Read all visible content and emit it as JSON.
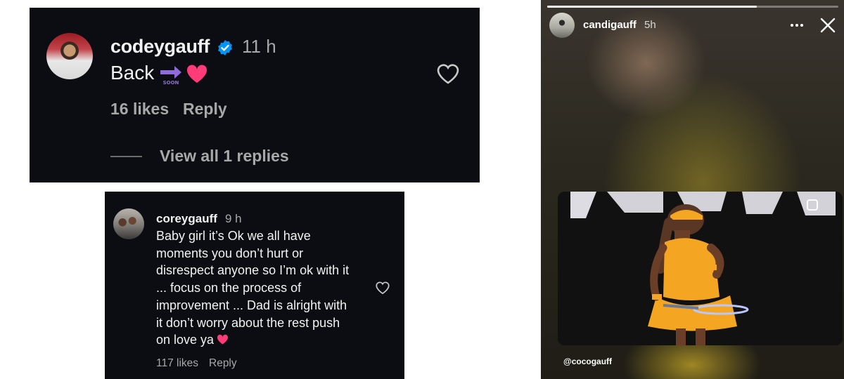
{
  "comment1": {
    "username": "codeygauff",
    "time": "11 h",
    "text": "Back",
    "likes": "16 likes",
    "reply": "Reply",
    "view_replies": "View all 1 replies",
    "emoji_icons": [
      "soon-arrow-icon",
      "heart-icon"
    ],
    "verified": true
  },
  "comment2": {
    "username": "coreygauff",
    "time": "9 h",
    "lines": [
      "Baby girl it’s Ok we all have",
      "moments you don’t hurt or",
      "disrespect anyone so I’m ok with it",
      "... focus on the process of",
      "improvement ... Dad is alright with",
      "it don’t worry about the rest push",
      "on love ya"
    ],
    "likes": "117 likes",
    "reply": "Reply"
  },
  "story": {
    "username": "candigauff",
    "time": "5h",
    "mention": "@cocogauff",
    "progress": 0.72
  },
  "colors": {
    "panel": "#0b0d12",
    "muted_text": "#a8a8a8",
    "verified_blue": "#0095f6",
    "heart_pink": "#ff3b7a",
    "arrow_purple": "#8e6bd8"
  }
}
